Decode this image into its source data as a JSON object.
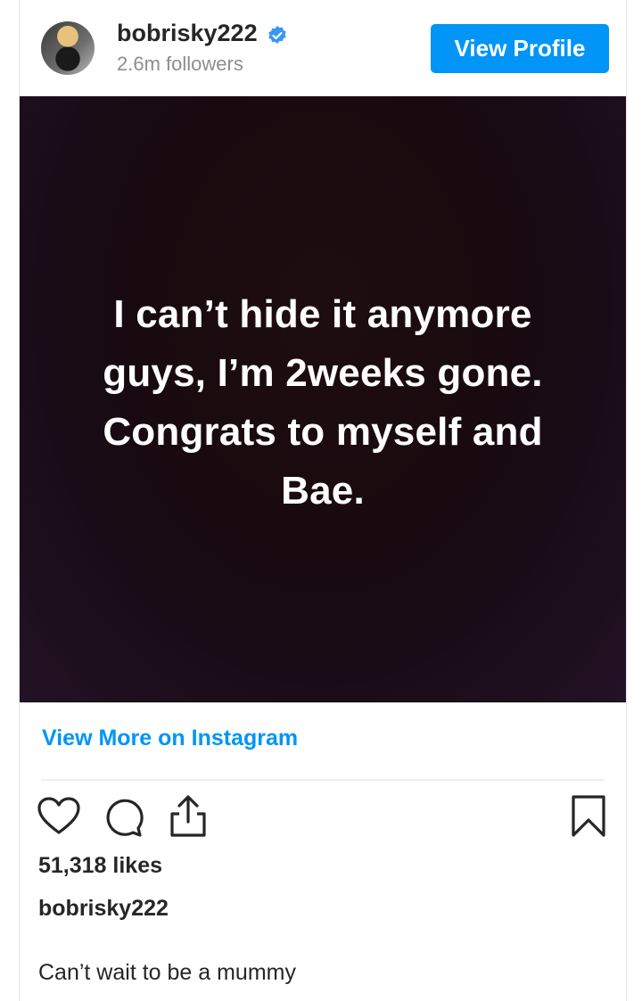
{
  "header": {
    "username": "bobrisky222",
    "followers": "2.6m followers",
    "view_profile_label": "View Profile"
  },
  "post": {
    "image_text_lines": [
      "I can’t hide it anymore",
      "guys, I’m 2weeks gone.",
      "Congrats to myself and",
      "Bae."
    ],
    "view_more_label": "View More on Instagram"
  },
  "actions": {
    "icons": [
      "heart-icon",
      "comment-icon",
      "share-icon",
      "bookmark-icon"
    ]
  },
  "stats": {
    "likes": "51,318 likes"
  },
  "caption": {
    "username": "bobrisky222",
    "text": "Can’t wait to be a mummy"
  },
  "colors": {
    "accent": "#0095f6",
    "image_background": "#1a0b12"
  }
}
